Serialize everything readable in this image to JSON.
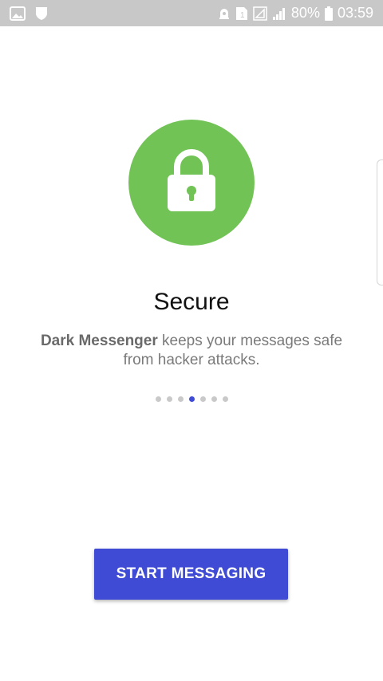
{
  "status_bar": {
    "battery_percent": "80%",
    "time": "03:59",
    "sim_label": "1",
    "icons": [
      "gallery-icon",
      "shield-icon",
      "alarm-icon",
      "sim-icon",
      "signal-icon",
      "battery-icon"
    ]
  },
  "onboarding": {
    "hero_icon": "lock-icon",
    "title": "Secure",
    "description_brand": "Dark Messenger",
    "description_text": " keeps your messages safe from hacker attacks.",
    "page_count": 7,
    "active_page": 3
  },
  "actions": {
    "start_label": "START MESSAGING"
  },
  "colors": {
    "accent": "#3f4bd4",
    "hero_green": "#72c356",
    "status_bar": "#c8c8c8"
  }
}
